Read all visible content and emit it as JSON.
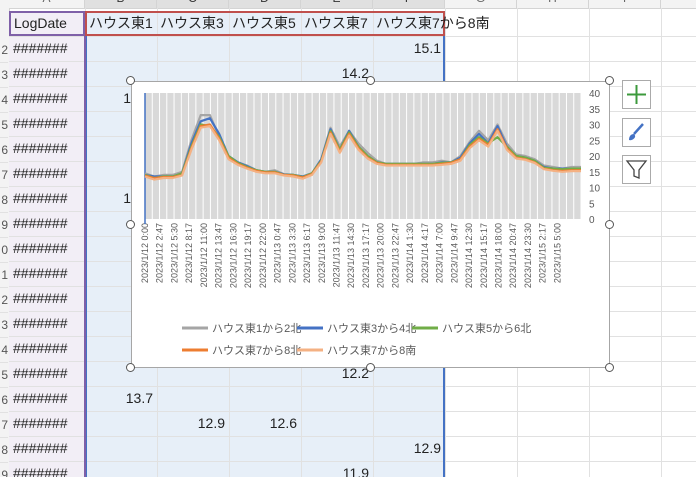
{
  "sheet": {
    "column_headers": [
      "A",
      "B",
      "C",
      "D",
      "E",
      "F",
      "G",
      "H",
      "I"
    ],
    "row_headers": [
      "2",
      "3",
      "4",
      "5",
      "6",
      "7",
      "8",
      "9",
      "0",
      "1",
      "2",
      "3",
      "4",
      "5",
      "6",
      "7",
      "8",
      "9"
    ],
    "header_row": {
      "a1": "LogDate",
      "b1": "ハウス東1",
      "c1": "ハウス東3",
      "d1": "ハウス東5",
      "e1": "ハウス東7",
      "f1": "ハウス東7から8南"
    },
    "date_placeholder": "#######",
    "visible_values": {
      "row2_f": "15.1",
      "row3_e": "14.2",
      "row4_b_partial": "1",
      "row8_b_partial": "1",
      "row15_e": "12.2",
      "row16_b": "13.7",
      "row17_c": "12.9",
      "row17_d": "12.6",
      "row18_f": "12.9",
      "row19_e": "11.9"
    }
  },
  "side_buttons": {
    "add_icon": "plus-icon",
    "style_icon": "brush-icon",
    "filter_icon": "filter-icon"
  },
  "chart_data": {
    "type": "line",
    "title": "",
    "xlabel": "",
    "ylabel": "",
    "ylim": [
      0,
      40
    ],
    "yticks": [
      "0",
      "5",
      "10",
      "15",
      "20",
      "25",
      "30",
      "35",
      "40"
    ],
    "y_axis_side": "right",
    "x_tick_labels": [
      "2023/1/12 0:00",
      "2023/1/12 2:47",
      "2023/1/12 5:30",
      "2023/1/12 8:17",
      "2023/1/12 11:00",
      "2023/1/12 13:47",
      "2023/1/12 16:30",
      "2023/1/12 19:17",
      "2023/1/12 22:00",
      "2023/1/13 0:47",
      "2023/1/13 3:30",
      "2023/1/13 6:17",
      "2023/1/13 9:00",
      "2023/1/13 11:47",
      "2023/1/13 14:30",
      "2023/1/13 17:17",
      "2023/1/13 20:00",
      "2023/1/13 22:47",
      "2023/1/14 1:30",
      "2023/1/14 4:17",
      "2023/1/14 7:00",
      "2023/1/14 9:47",
      "2023/1/14 12:30",
      "2023/1/14 15:17",
      "2023/1/14 18:00",
      "2023/1/14 20:47",
      "2023/1/14 23:30",
      "2023/1/15 2:17",
      "2023/1/15 5:00"
    ],
    "legend_position": "bottom",
    "grid": true,
    "series": [
      {
        "name": "ハウス東1から2北",
        "color": "#a5a5a5",
        "values": [
          14.5,
          13.5,
          14,
          14,
          15,
          25,
          33,
          33,
          26,
          20,
          18,
          17,
          15.5,
          15,
          15.5,
          14.2,
          14,
          13.5,
          14.5,
          19,
          29,
          23,
          28,
          24,
          21,
          18.5,
          17.5,
          17.5,
          17.5,
          17.5,
          18,
          18,
          18.5,
          18,
          20,
          24.5,
          28,
          25,
          30,
          24,
          20.5,
          20,
          19,
          17,
          16.5,
          16,
          16.5,
          16.5
        ]
      },
      {
        "name": "ハウス東3から4北",
        "color": "#4472c4",
        "values": [
          14,
          13.5,
          13.5,
          13.5,
          14.5,
          24,
          31,
          32,
          27,
          20,
          18,
          16.8,
          15.5,
          15,
          15,
          14.2,
          14,
          13.5,
          14.5,
          19,
          28.5,
          22,
          28,
          23,
          20,
          18,
          17.5,
          17.5,
          17.5,
          17.5,
          17.5,
          17.5,
          18,
          18,
          19.5,
          24,
          27,
          24,
          29.5,
          23,
          20,
          19.5,
          18.5,
          16.5,
          16,
          16,
          16,
          16
        ]
      },
      {
        "name": "ハウス東5から6北",
        "color": "#70ad47",
        "values": [
          14,
          13,
          13.5,
          13.5,
          14.5,
          23,
          30,
          29.5,
          26,
          20,
          17.8,
          16.5,
          15.5,
          15,
          15,
          14,
          14,
          13.3,
          14.5,
          18.5,
          28,
          22,
          27.5,
          23,
          20,
          18,
          17.5,
          17.5,
          17.5,
          17.5,
          17.5,
          17.5,
          17.8,
          18,
          19,
          23.5,
          26,
          24,
          26,
          23,
          20,
          19.5,
          18.5,
          16.3,
          16,
          15.8,
          16,
          16
        ]
      },
      {
        "name": "ハウス東7から8北",
        "color": "#ed7d31",
        "values": [
          13.8,
          13,
          13.3,
          13.3,
          14,
          22.5,
          29.5,
          30,
          25.5,
          19.5,
          17.5,
          16.3,
          15.3,
          14.8,
          14.8,
          14,
          13.8,
          13.2,
          14.3,
          18.3,
          27.5,
          21.5,
          27,
          22.5,
          19.5,
          17.8,
          17.2,
          17.2,
          17.2,
          17.2,
          17.2,
          17.2,
          17.5,
          17.8,
          19,
          23,
          25.5,
          23.5,
          28.5,
          22.5,
          19.5,
          19,
          18,
          16,
          15.5,
          15.3,
          15.5,
          15.5
        ]
      },
      {
        "name": "ハウス東7から8南",
        "color": "#f4b183",
        "values": [
          13.5,
          12.5,
          13,
          13,
          13.8,
          22,
          29,
          29.5,
          25,
          19,
          17.2,
          16,
          15,
          14.5,
          14.5,
          13.8,
          13.5,
          12.8,
          14,
          18,
          27,
          21,
          26.5,
          22,
          19.2,
          17.5,
          17,
          17,
          17,
          17,
          17,
          17,
          17.2,
          17.5,
          18.5,
          22.5,
          25,
          23,
          28,
          22,
          19.2,
          18.8,
          17.8,
          15.8,
          15.3,
          15,
          15.2,
          15.2
        ]
      }
    ]
  }
}
